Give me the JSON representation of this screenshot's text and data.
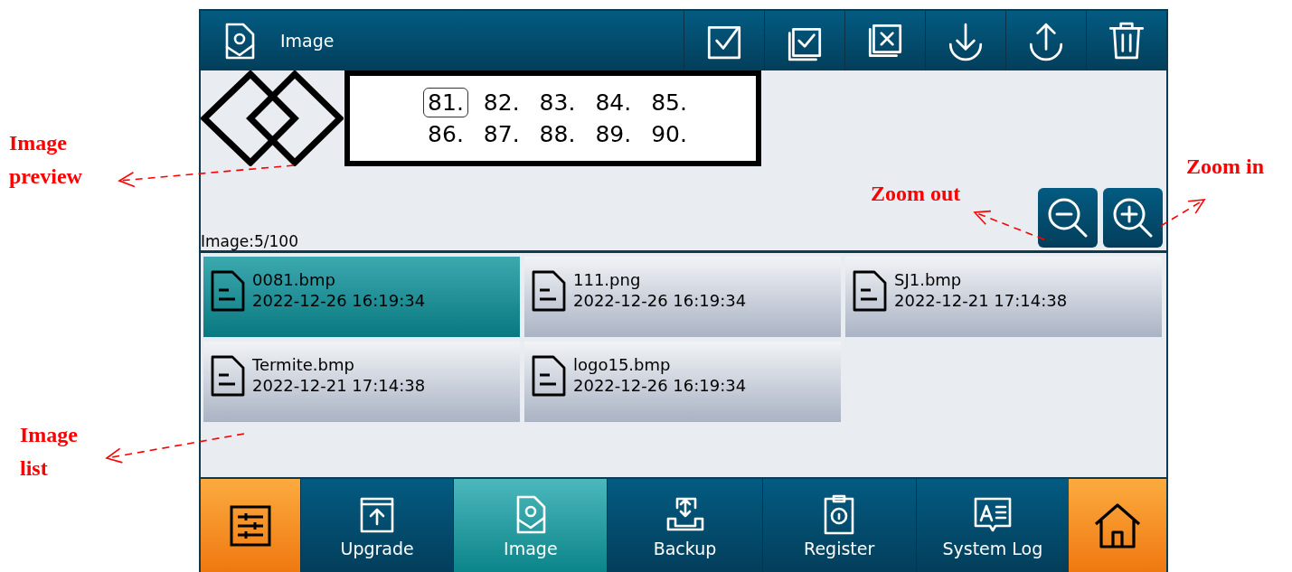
{
  "header": {
    "title": "Image"
  },
  "toolbar": [
    {
      "kind": "check"
    },
    {
      "kind": "check-all"
    },
    {
      "kind": "uncheck-all"
    },
    {
      "kind": "download"
    },
    {
      "kind": "upload"
    },
    {
      "kind": "delete"
    }
  ],
  "preview": {
    "rows": [
      [
        {
          "text": "81.",
          "selected": true
        },
        {
          "text": "82.",
          "selected": false
        },
        {
          "text": "83.",
          "selected": false
        },
        {
          "text": "84.",
          "selected": false
        },
        {
          "text": "85.",
          "selected": false
        }
      ],
      [
        {
          "text": "86.",
          "selected": false
        },
        {
          "text": "87.",
          "selected": false
        },
        {
          "text": "88.",
          "selected": false
        },
        {
          "text": "89.",
          "selected": false
        },
        {
          "text": "90.",
          "selected": false
        }
      ]
    ],
    "counter": "Image:5/100"
  },
  "zoom": [
    {
      "kind": "zoom-out"
    },
    {
      "kind": "zoom-in"
    }
  ],
  "files": [
    {
      "name": "0081.bmp",
      "date": "2022-12-26 16:19:34",
      "selected": true
    },
    {
      "name": "111.png",
      "date": "2022-12-26 16:19:34",
      "selected": false
    },
    {
      "name": "SJ1.bmp",
      "date": "2022-12-21 17:14:38",
      "selected": false
    },
    {
      "name": "Termite.bmp",
      "date": "2022-12-21 17:14:38",
      "selected": false
    },
    {
      "name": "logo15.bmp",
      "date": "2022-12-26 16:19:34",
      "selected": false
    }
  ],
  "nav": [
    {
      "kind": "settings"
    },
    {
      "kind": "upgrade",
      "label": "Upgrade",
      "selected": false
    },
    {
      "kind": "image",
      "label": "Image",
      "selected": true
    },
    {
      "kind": "backup",
      "label": "Backup",
      "selected": false
    },
    {
      "kind": "register",
      "label": "Register",
      "selected": false
    },
    {
      "kind": "log",
      "label": "System Log",
      "selected": false
    },
    {
      "kind": "home"
    }
  ],
  "annotations": [
    {
      "text": "Image preview"
    },
    {
      "text": "Image list"
    },
    {
      "text": "Zoom out"
    },
    {
      "text": "Zoom in"
    }
  ]
}
